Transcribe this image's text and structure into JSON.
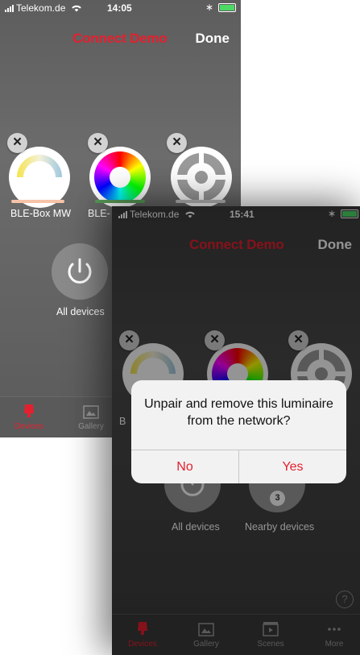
{
  "colors": {
    "accent": "#e5202e",
    "battery": "#4cd964"
  },
  "back_screen": {
    "status": {
      "carrier": "Telekom.de",
      "time": "14:05"
    },
    "nav": {
      "title": "Connect Demo",
      "done": "Done"
    },
    "devices": [
      {
        "label": "BLE-Box MW",
        "type": "white-tunable",
        "underline_color": "#f6c3a8"
      },
      {
        "label": "BLE-",
        "type": "rgb",
        "underline_color": "#5a9d5a"
      },
      {
        "label": "",
        "type": "sensor",
        "underline_color": "#bdbdbd"
      }
    ],
    "all_devices": "All devices",
    "tabs": [
      {
        "label": "Devices",
        "icon": "lamp-icon",
        "active": true
      },
      {
        "label": "Gallery",
        "icon": "gallery-icon",
        "active": false
      }
    ]
  },
  "front_screen": {
    "status": {
      "carrier": "Telekom.de",
      "time": "15:41"
    },
    "nav": {
      "title": "Connect Demo",
      "done": "Done"
    },
    "partial_label": "B",
    "all_devices": "All devices",
    "nearby_devices": "Nearby devices",
    "nearby_count": "3",
    "help": "?",
    "tabs": [
      {
        "label": "Devices",
        "icon": "lamp-icon"
      },
      {
        "label": "Gallery",
        "icon": "gallery-icon"
      },
      {
        "label": "Scenes",
        "icon": "scenes-icon"
      },
      {
        "label": "More",
        "icon": "more-icon"
      }
    ],
    "alert": {
      "message": "Unpair and remove this luminaire from the network?",
      "no": "No",
      "yes": "Yes"
    }
  }
}
